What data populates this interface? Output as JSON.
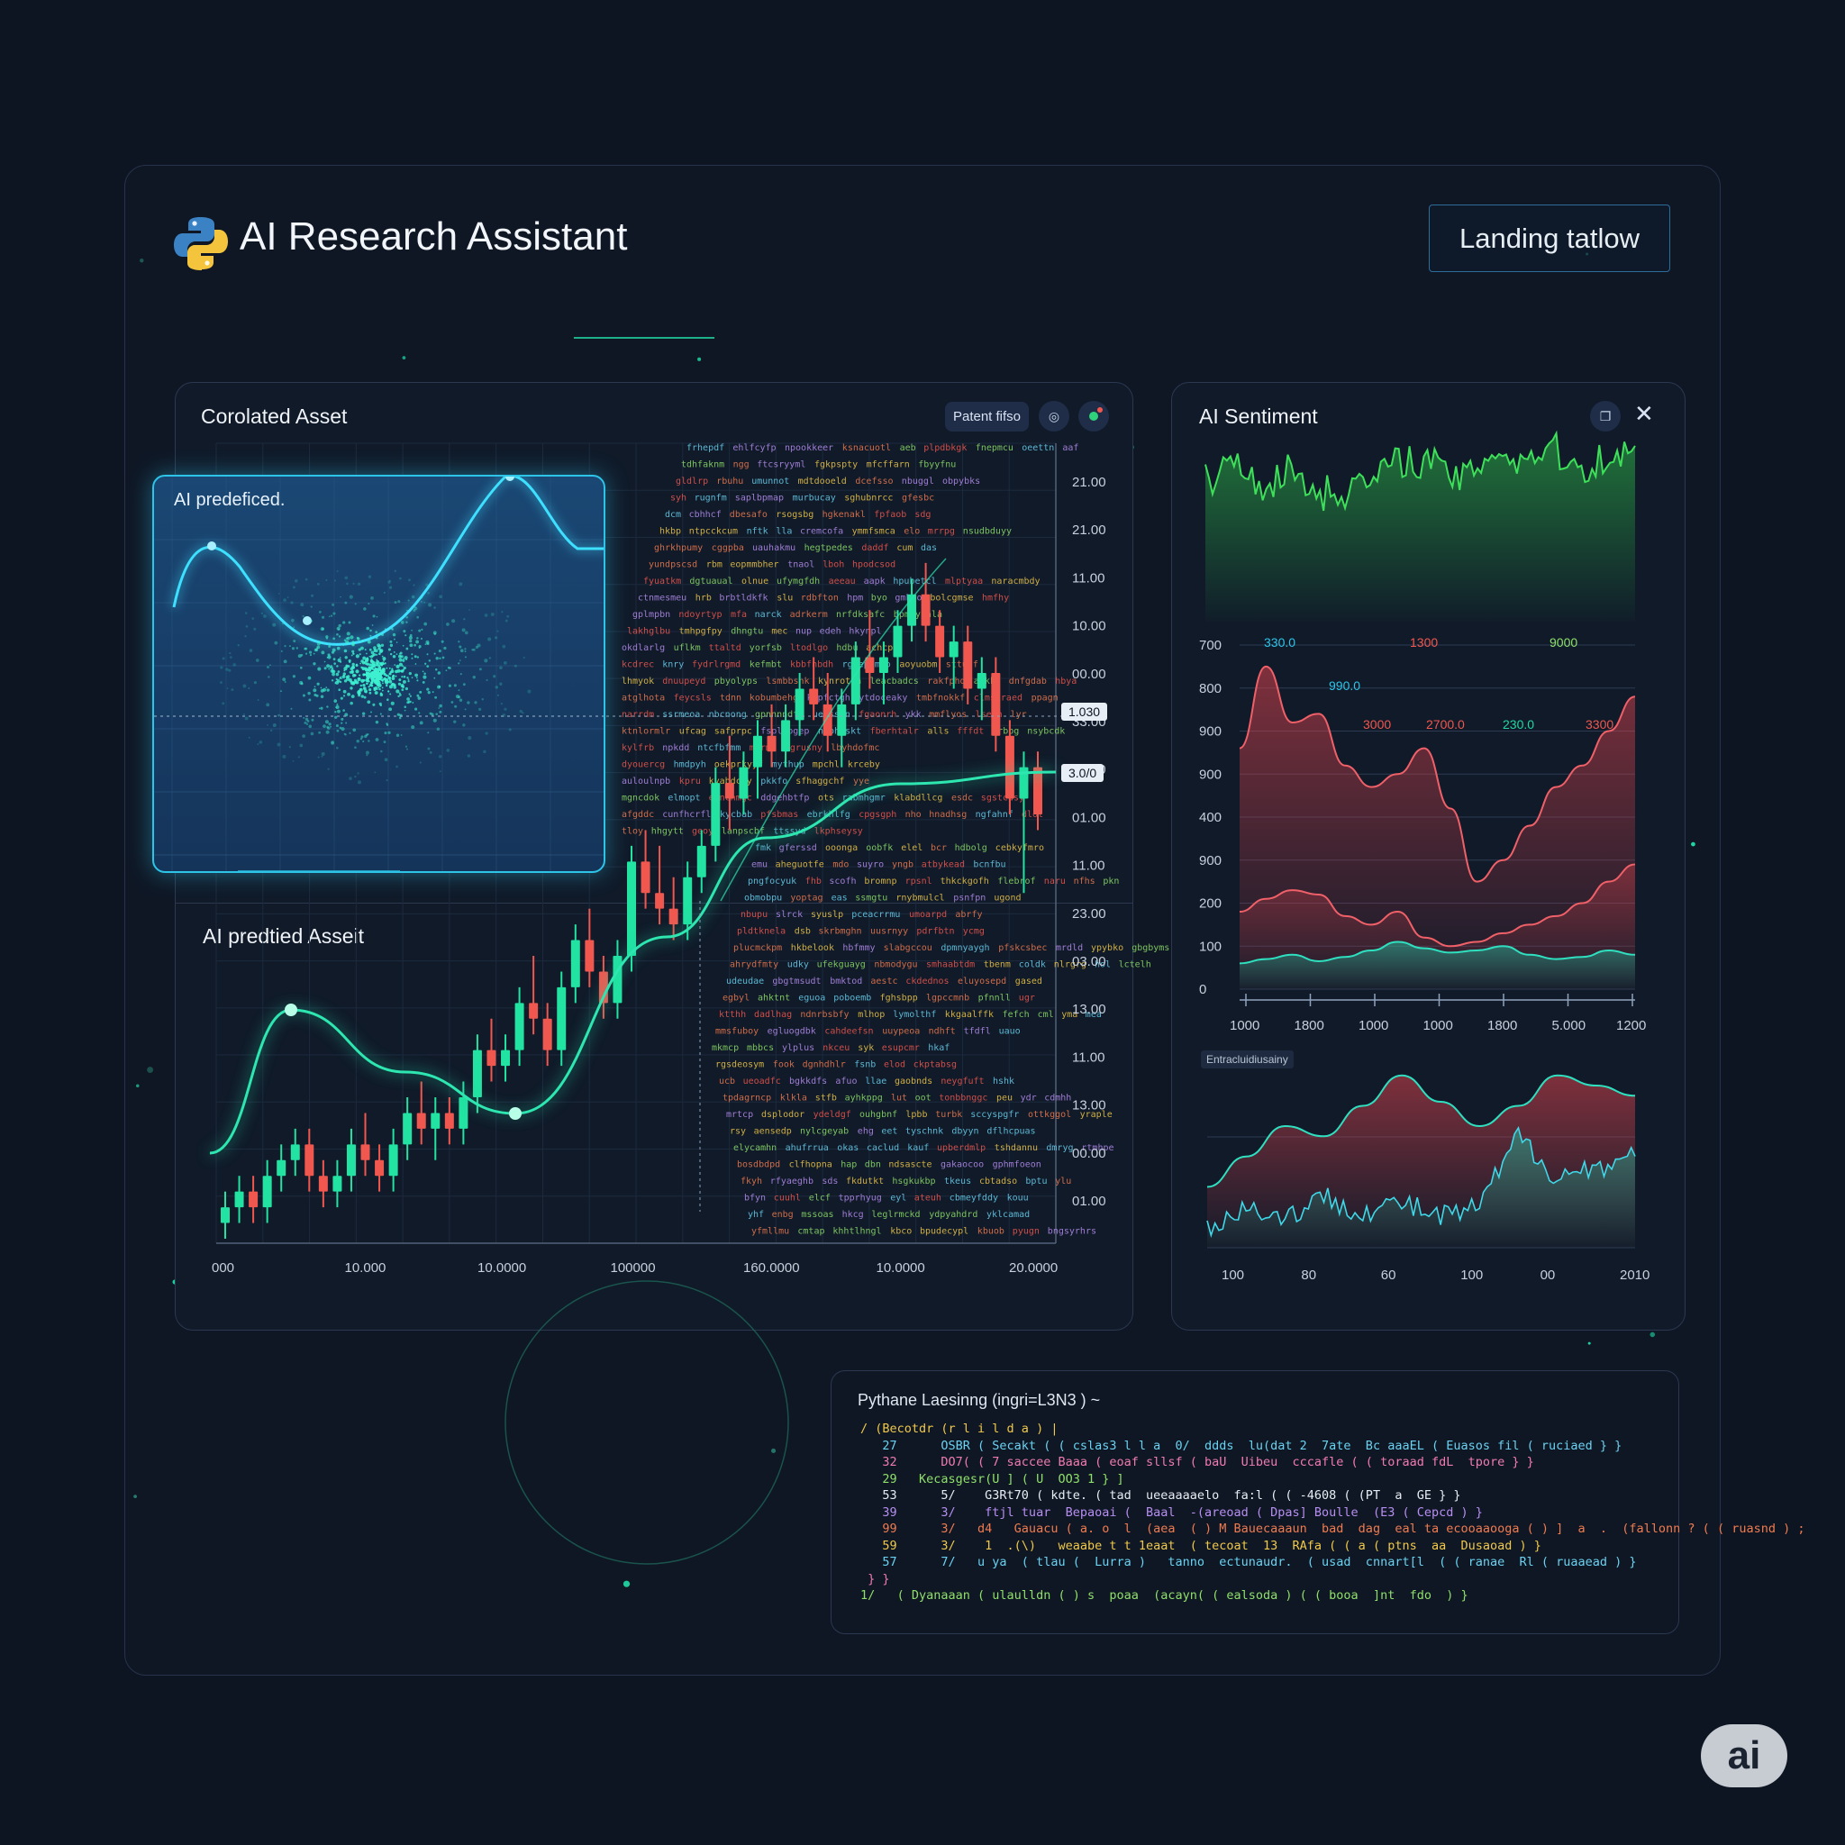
{
  "header": {
    "title": "AI Research Assistant",
    "button_label": "Landing tatlow"
  },
  "colors": {
    "bg": "#0e1522",
    "panel": "#101a29",
    "border": "#2b3850",
    "accent": "#1fd8a3",
    "up": "#22e3a2",
    "down": "#f0584f",
    "cyan": "#2ec4e8"
  },
  "icons": [
    "python-logo-icon",
    "settings-icon",
    "status-icon",
    "copy-icon",
    "close-icon"
  ],
  "left_panel": {
    "title": "Corolated Asset",
    "chip_label": "Patent fifso",
    "inset_title": "AI predeficed.",
    "lower_title": "AI predtied Asseit",
    "price_labels": [
      "1.030",
      "3.0/0"
    ]
  },
  "right_panel": {
    "title": "AI Sentiment",
    "mid_label": "Entracluidiusainy"
  },
  "code_panel": {
    "title": "Pythane Laesinng (ingri=L3N3 ) ~",
    "lines": [
      "/ (Becotdr (r l i l d a ) |",
      "   27      OSBR ( Secakt ( ( cslas3 l l a  0/  ddds  lu(dat 2  7ate  Bc aaaEL ( Euasos fil ( ruciaed } }",
      "   32      DO7( ( 7 saccee Baaa ( eoaf sllsf ( baU  Uibeu  cccafle ( ( toraad fdL  tpore } }",
      "   29   Kecasgesr(U ] ( U  OO3 1 } ]",
      "   53      5/    G3Rt70 ( kdte. ( tad  ueeaaaaelo  fa:l ( ( -4608 ( (PT  a  GE } }",
      "   39      3/    ftjl tuar  Bepaoai (  Baal  -(areoad ( Dpas] Boulle  (E3 ( Cepcd ) }",
      "   99      3/   d4   Gauacu ( a. o  l  (aea  ( ) M Bauecaaaun  bad  dag  eal ta ecooaaooga ( ) ]  a  .  (fallonn ? ( ( ruasnd ) ;",
      "   59      3/    1  .(\\)   weaabe t t 1eaat  ( tecoat  13  RAfa ( ( a ( ptns  aa  Dusaoad ) }",
      "   57      7/   u ya  ( tlau (  Lurra )   tanno  ectunaudr.  ( usad  cnnart[l  ( ( ranae  Rl ( ruaaead ) }",
      " } }",
      "1/   ( Dyanaaan ( ulaulldn ( ) s  poaa  (acayn( ( ealsoda ) ( ( booa  ]nt  fdo  ) }"
    ]
  },
  "corner_badge": "ai",
  "chart_data": [
    {
      "type": "candlestick",
      "title": "Corolated Asset",
      "x_tick_labels": [
        "000",
        "10.000",
        "10.0000",
        "100000",
        "160.0000",
        "10.0000",
        "20.0000"
      ],
      "y_tick_labels": [
        "21.00",
        "21.00",
        "11.00",
        "10.00",
        "00.00",
        "33.00",
        "01.00",
        "01.00",
        "11.00",
        "23.00",
        "03.00",
        "13.00",
        "11.00",
        "13.00",
        "00.00",
        "01.00"
      ],
      "ohlc": [
        [
          1,
          3,
          0,
          2
        ],
        [
          2,
          4,
          1,
          3
        ],
        [
          3,
          4,
          1,
          2
        ],
        [
          2,
          5,
          1,
          4
        ],
        [
          4,
          6,
          3,
          5
        ],
        [
          5,
          7,
          4,
          6
        ],
        [
          6,
          7,
          3,
          4
        ],
        [
          4,
          5,
          2,
          3
        ],
        [
          3,
          5,
          2,
          4
        ],
        [
          4,
          7,
          3,
          6
        ],
        [
          6,
          8,
          4,
          5
        ],
        [
          5,
          6,
          3,
          4
        ],
        [
          4,
          7,
          3,
          6
        ],
        [
          6,
          9,
          5,
          8
        ],
        [
          8,
          10,
          6,
          7
        ],
        [
          7,
          9,
          5,
          8
        ],
        [
          8,
          9,
          6,
          7
        ],
        [
          7,
          10,
          6,
          9
        ],
        [
          9,
          13,
          8,
          12
        ],
        [
          12,
          14,
          10,
          11
        ],
        [
          11,
          13,
          10,
          12
        ],
        [
          12,
          16,
          11,
          15
        ],
        [
          15,
          18,
          13,
          14
        ],
        [
          14,
          15,
          11,
          12
        ],
        [
          12,
          17,
          11,
          16
        ],
        [
          16,
          20,
          15,
          19
        ],
        [
          19,
          21,
          16,
          17
        ],
        [
          17,
          18,
          14,
          15
        ],
        [
          15,
          19,
          14,
          18
        ],
        [
          18,
          25,
          17,
          24
        ],
        [
          24,
          26,
          21,
          22
        ],
        [
          22,
          25,
          20,
          21
        ],
        [
          21,
          23,
          19,
          20
        ],
        [
          20,
          24,
          19,
          23
        ],
        [
          23,
          26,
          22,
          25
        ],
        [
          25,
          30,
          24,
          29
        ],
        [
          29,
          32,
          26,
          28
        ],
        [
          28,
          31,
          27,
          30
        ],
        [
          30,
          33,
          28,
          32
        ],
        [
          32,
          34,
          30,
          31
        ],
        [
          31,
          34,
          30,
          33
        ],
        [
          33,
          36,
          32,
          35
        ],
        [
          35,
          37,
          33,
          34
        ],
        [
          34,
          36,
          31,
          32
        ],
        [
          32,
          35,
          30,
          34
        ],
        [
          34,
          38,
          33,
          37
        ],
        [
          37,
          40,
          35,
          36
        ],
        [
          36,
          38,
          34,
          37
        ],
        [
          37,
          40,
          36,
          39
        ],
        [
          39,
          42,
          38,
          41
        ],
        [
          41,
          43,
          38,
          39
        ],
        [
          39,
          40,
          36,
          37
        ],
        [
          37,
          39,
          35,
          38
        ],
        [
          38,
          39,
          34,
          35
        ],
        [
          35,
          37,
          33,
          36
        ],
        [
          36,
          37,
          31,
          32
        ],
        [
          32,
          33,
          27,
          28
        ],
        [
          28,
          31,
          22,
          30
        ],
        [
          30,
          31,
          26,
          27
        ]
      ],
      "trend": [
        0.05,
        0.25,
        0.35,
        0.45,
        0.6,
        0.78,
        0.88,
        0.93
      ]
    },
    {
      "type": "area",
      "title": "AI Sentiment",
      "y_tick_labels": [
        "700",
        "800",
        "900",
        "900",
        "400",
        "900",
        "200",
        "100",
        "0"
      ],
      "x_tick_labels": [
        "1000",
        "1800",
        "1000",
        "1000",
        "1800",
        "5.000",
        "1200"
      ],
      "value_labels": [
        "330.0",
        "1300",
        "9000",
        "990.0",
        "3000",
        "2700.0",
        "230.0",
        "3300"
      ],
      "series": [
        {
          "values": [
            2.9,
            3.4,
            2.8,
            3.2,
            2.6,
            2.7,
            3.0,
            3.5,
            3.3,
            2.9,
            3.7,
            3.4,
            3.8,
            3.2,
            3.5,
            3.6
          ]
        },
        {
          "values": [
            560,
            750,
            620,
            640,
            520,
            470,
            500,
            560,
            420,
            250,
            300,
            380,
            470,
            520,
            600,
            680
          ]
        },
        {
          "values": [
            180,
            210,
            230,
            220,
            170,
            150,
            180,
            120,
            100,
            110,
            130,
            150,
            170,
            200,
            250,
            290
          ]
        },
        {
          "values": [
            60,
            70,
            80,
            65,
            75,
            90,
            110,
            95,
            85,
            90,
            100,
            80,
            70,
            75,
            90,
            80
          ]
        }
      ]
    },
    {
      "type": "area",
      "x_tick_labels": [
        "100",
        "80",
        "60",
        "100",
        "00",
        "2010"
      ],
      "series": [
        {
          "values": [
            0.3,
            0.45,
            0.6,
            0.55,
            0.7,
            0.85,
            0.72,
            0.6,
            0.7,
            0.85,
            0.8,
            0.75
          ]
        },
        {
          "values": [
            0.1,
            0.2,
            0.15,
            0.25,
            0.18,
            0.22,
            0.15,
            0.2,
            0.55,
            0.35,
            0.4,
            0.45
          ]
        }
      ]
    }
  ]
}
